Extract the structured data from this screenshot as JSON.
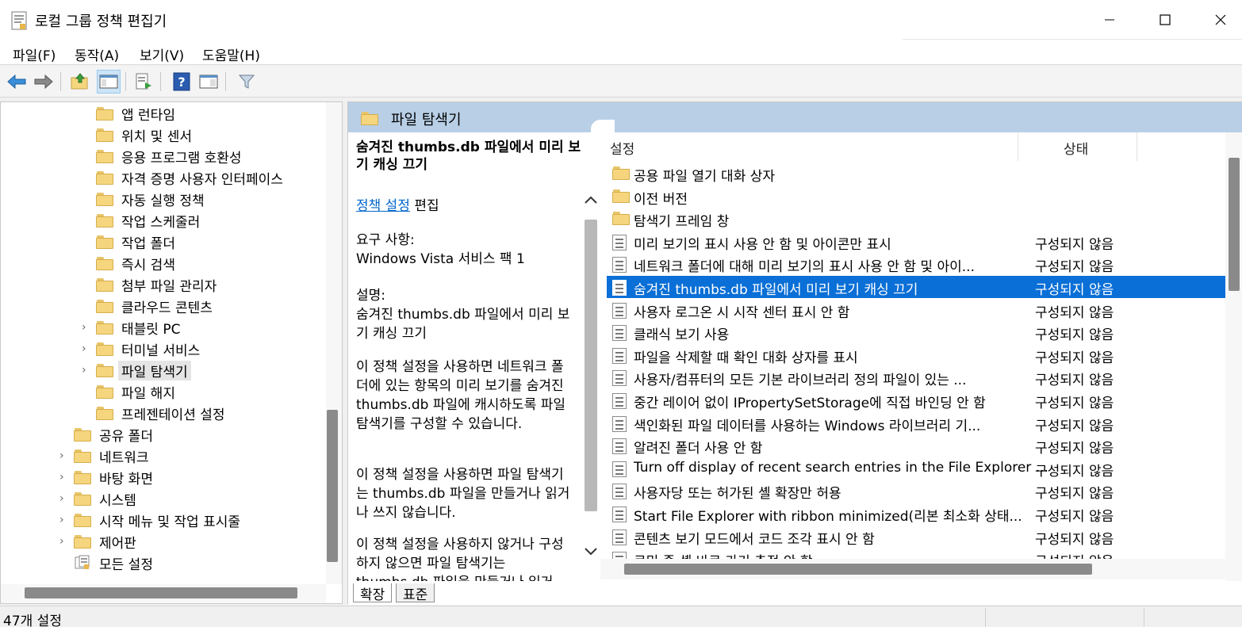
{
  "window": {
    "title": "로컬 그룹 정책 편집기"
  },
  "menu": [
    "파일(F)",
    "동작(A)",
    "보기(V)",
    "도움말(H)"
  ],
  "toolbar": {
    "buttons": [
      "back-icon",
      "forward-icon",
      "up-folder-icon",
      "show-hide-tree-icon",
      "export-list-icon",
      "help-icon",
      "properties-icon",
      "filter-icon"
    ]
  },
  "tree": {
    "items": [
      {
        "label": "앱 런타임",
        "level": 2,
        "expandable": false
      },
      {
        "label": "위치 및 센서",
        "level": 2,
        "expandable": false
      },
      {
        "label": "응용 프로그램 호환성",
        "level": 2,
        "expandable": false
      },
      {
        "label": "자격 증명 사용자 인터페이스",
        "level": 2,
        "expandable": false
      },
      {
        "label": "자동 실행 정책",
        "level": 2,
        "expandable": false
      },
      {
        "label": "작업 스케줄러",
        "level": 2,
        "expandable": false
      },
      {
        "label": "작업 폴더",
        "level": 2,
        "expandable": false
      },
      {
        "label": "즉시 검색",
        "level": 2,
        "expandable": false
      },
      {
        "label": "첨부 파일 관리자",
        "level": 2,
        "expandable": false
      },
      {
        "label": "클라우드 콘텐츠",
        "level": 2,
        "expandable": false
      },
      {
        "label": "태블릿 PC",
        "level": 2,
        "expandable": true
      },
      {
        "label": "터미널 서비스",
        "level": 2,
        "expandable": true
      },
      {
        "label": "파일 탐색기",
        "level": 2,
        "expandable": true,
        "selected": true
      },
      {
        "label": "파일 해지",
        "level": 2,
        "expandable": false
      },
      {
        "label": "프레젠테이션 설정",
        "level": 2,
        "expandable": false
      },
      {
        "label": "공유 폴더",
        "level": 1,
        "expandable": false
      },
      {
        "label": "네트워크",
        "level": 1,
        "expandable": true
      },
      {
        "label": "바탕 화면",
        "level": 1,
        "expandable": true
      },
      {
        "label": "시스템",
        "level": 1,
        "expandable": true
      },
      {
        "label": "시작 메뉴 및 작업 표시줄",
        "level": 1,
        "expandable": true
      },
      {
        "label": "제어판",
        "level": 1,
        "expandable": true
      },
      {
        "label": "모든 설정",
        "level": 1,
        "expandable": false,
        "icon": "all-settings-icon"
      }
    ]
  },
  "right_header": {
    "title": "파일 탐색기"
  },
  "description": {
    "title": "숨겨진 thumbs.db 파일에서 미리 보기 캐싱 끄기",
    "link": "정책 설정",
    "link_suffix": "편집",
    "req_label": "요구 사항:",
    "req_value": "Windows Vista 서비스 팩 1",
    "desc_label": "설명:",
    "desc_value": "숨겨진 thumbs.db 파일에서 미리 보기 캐싱 끄기",
    "para1": "이 정책 설정을 사용하면 네트워크 폴더에 있는 항목의 미리 보기를 숨겨진 thumbs.db 파일에 캐시하도록 파일 탐색기를 구성할 수 있습니다.",
    "para2": "이 정책 설정을 사용하면 파일 탐색기는 thumbs.db 파일을 만들거나 읽거나 쓰지 않습니다.",
    "para3": "이 정책 설정을 사용하지 않거나 구성하지 않으면 파일 탐색기는 thumbs.db 파일을 만들거나 읽거"
  },
  "table": {
    "col_setting": "설정",
    "col_state": "상태",
    "rows": [
      {
        "name": "공용 파일 열기 대화 상자",
        "state": "",
        "type": "folder"
      },
      {
        "name": "이전 버전",
        "state": "",
        "type": "folder"
      },
      {
        "name": "탐색기 프레임 창",
        "state": "",
        "type": "folder"
      },
      {
        "name": "미리 보기의 표시 사용 안 함 및 아이콘만 표시",
        "state": "구성되지 않음",
        "type": "setting"
      },
      {
        "name": "네트워크 폴더에 대해 미리 보기의 표시 사용 안 함 및 아이...",
        "state": "구성되지 않음",
        "type": "setting"
      },
      {
        "name": "숨겨진 thumbs.db 파일에서 미리 보기 캐싱 끄기",
        "state": "구성되지 않음",
        "type": "setting",
        "selected": true
      },
      {
        "name": "사용자 로그온 시 시작 센터 표시 안 함",
        "state": "구성되지 않음",
        "type": "setting"
      },
      {
        "name": "클래식 보기 사용",
        "state": "구성되지 않음",
        "type": "setting"
      },
      {
        "name": "파일을 삭제할 때 확인 대화 상자를 표시",
        "state": "구성되지 않음",
        "type": "setting"
      },
      {
        "name": "사용자/컴퓨터의 모든 기본 라이브러리 정의 파일이 있는 ...",
        "state": "구성되지 않음",
        "type": "setting"
      },
      {
        "name": "중간 레이어 없이 IPropertySetStorage에 직접 바인딩 안 함",
        "state": "구성되지 않음",
        "type": "setting"
      },
      {
        "name": "색인화된 파일 데이터를 사용하는 Windows 라이브러리 기...",
        "state": "구성되지 않음",
        "type": "setting"
      },
      {
        "name": "알려진 폴더 사용 안 함",
        "state": "구성되지 않음",
        "type": "setting"
      },
      {
        "name": "Turn off display of recent search entries in the File Explorer ...",
        "state": "구성되지 않음",
        "type": "setting"
      },
      {
        "name": "사용자당 또는 허가된 셸 확장만 허용",
        "state": "구성되지 않음",
        "type": "setting"
      },
      {
        "name": "Start File Explorer with ribbon minimized(리본 최소화 상태...",
        "state": "구성되지 않음",
        "type": "setting"
      },
      {
        "name": "콘텐츠 보기 모드에서 코드 조각 표시 안 함",
        "state": "구성되지 않음",
        "type": "setting"
      },
      {
        "name": "로밍 중 셸 바로 가기 추적 안 함",
        "state": "구성되지 않음",
        "type": "setting"
      }
    ]
  },
  "bottom_tabs": [
    "확장",
    "표준"
  ],
  "status": {
    "text": "47개 설정"
  }
}
